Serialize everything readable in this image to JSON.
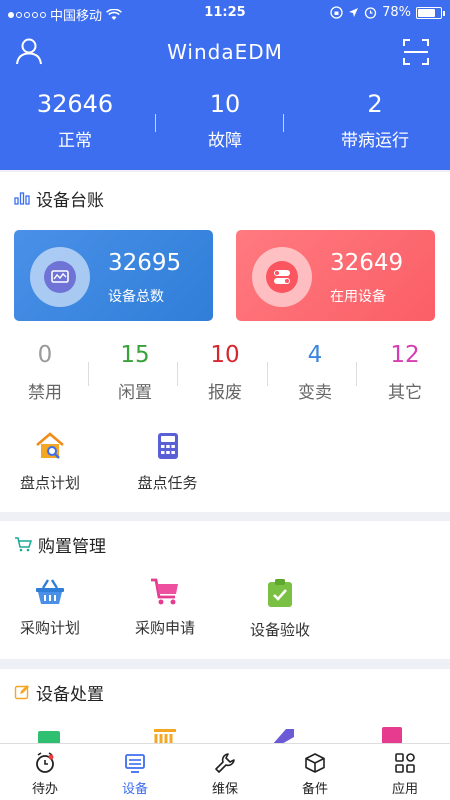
{
  "statusbar": {
    "carrier": "中国移动",
    "time": "11:25",
    "battery": "78%",
    "battery_level": 0.78
  },
  "header": {
    "title": "WindaEDM",
    "stats": [
      {
        "value": "32646",
        "label": "正常"
      },
      {
        "value": "10",
        "label": "故障"
      },
      {
        "value": "2",
        "label": "带病运行"
      }
    ]
  },
  "ledger": {
    "title": "设备台账",
    "cards": [
      {
        "value": "32695",
        "label": "设备总数",
        "color": "#3a86e0"
      },
      {
        "value": "32649",
        "label": "在用设备",
        "color": "#fd6a72"
      }
    ],
    "counts": [
      {
        "value": "0",
        "label": "禁用",
        "color": "#9a9a9a"
      },
      {
        "value": "15",
        "label": "闲置",
        "color": "#3aa23a"
      },
      {
        "value": "10",
        "label": "报废",
        "color": "#d7262e"
      },
      {
        "value": "4",
        "label": "变卖",
        "color": "#3a86e0"
      },
      {
        "value": "12",
        "label": "其它",
        "color": "#d63db1"
      }
    ],
    "actions": [
      {
        "label": "盘点计划",
        "icon": "house-search-icon"
      },
      {
        "label": "盘点任务",
        "icon": "calculator-icon"
      }
    ]
  },
  "purchase": {
    "title": "购置管理",
    "actions": [
      {
        "label": "采购计划",
        "icon": "basket-icon"
      },
      {
        "label": "采购申请",
        "icon": "cart-icon"
      },
      {
        "label": "设备验收",
        "icon": "clipboard-check-icon"
      }
    ]
  },
  "disposal": {
    "title": "设备处置"
  },
  "tabs": [
    {
      "label": "待办",
      "icon": "alarm-icon",
      "active": false
    },
    {
      "label": "设备",
      "icon": "device-icon",
      "active": true
    },
    {
      "label": "维保",
      "icon": "wrench-icon",
      "active": false
    },
    {
      "label": "备件",
      "icon": "box-icon",
      "active": false
    },
    {
      "label": "应用",
      "icon": "apps-icon",
      "active": false
    }
  ],
  "colors": {
    "primary": "#3d6ef0",
    "background": "#eef0f5"
  }
}
